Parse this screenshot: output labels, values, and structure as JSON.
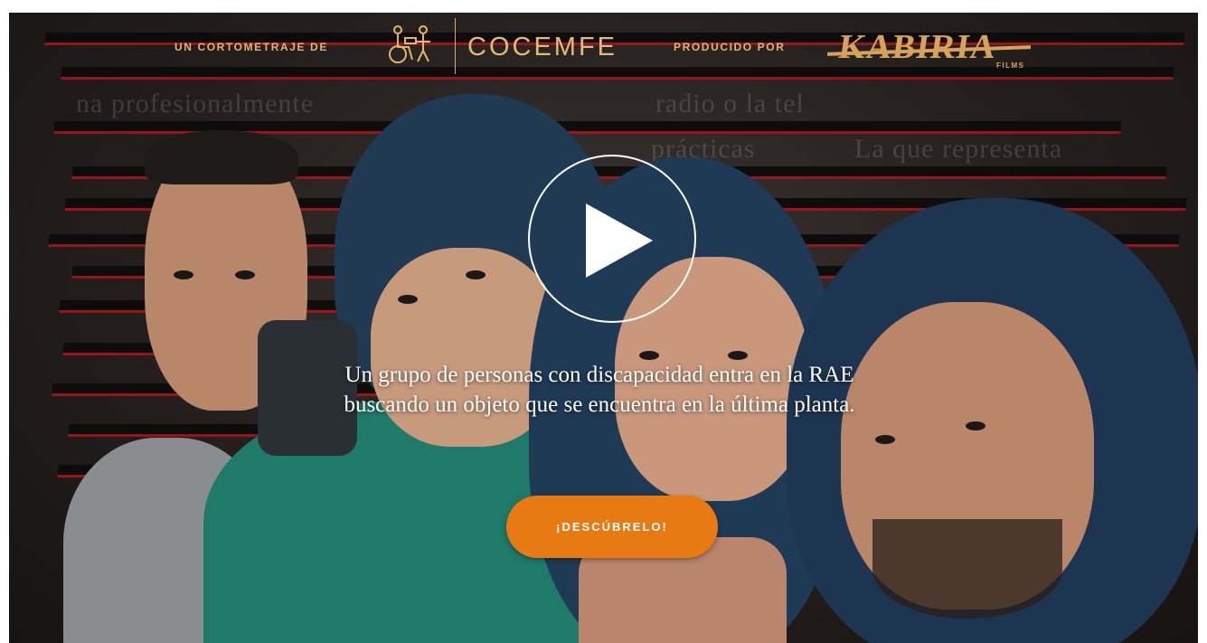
{
  "header": {
    "by_label": "UN CORTOMETRAJE DE",
    "org_name": "COCEMFE",
    "produced_label": "PRODUCIDO POR",
    "producer_name": "KABIRIA",
    "producer_sub": "FILMS"
  },
  "background": {
    "document_fragments": [
      "na profesionalmente",
      "radio o la tel",
      "prácticas",
      "La que representa"
    ]
  },
  "play": {
    "icon": "play-icon"
  },
  "tagline": "Un grupo de personas con discapacidad entra en la RAE buscando un objeto que se encuentra en la última planta.",
  "cta": {
    "label": "¡DESCÚBRELO!"
  },
  "colors": {
    "accent_gold": "#e0b56a",
    "cta_orange": "#e77a12",
    "hood_navy": "#1f3a52",
    "jacket_green": "#1f7a6a",
    "redaction_red": "#a3141a"
  }
}
